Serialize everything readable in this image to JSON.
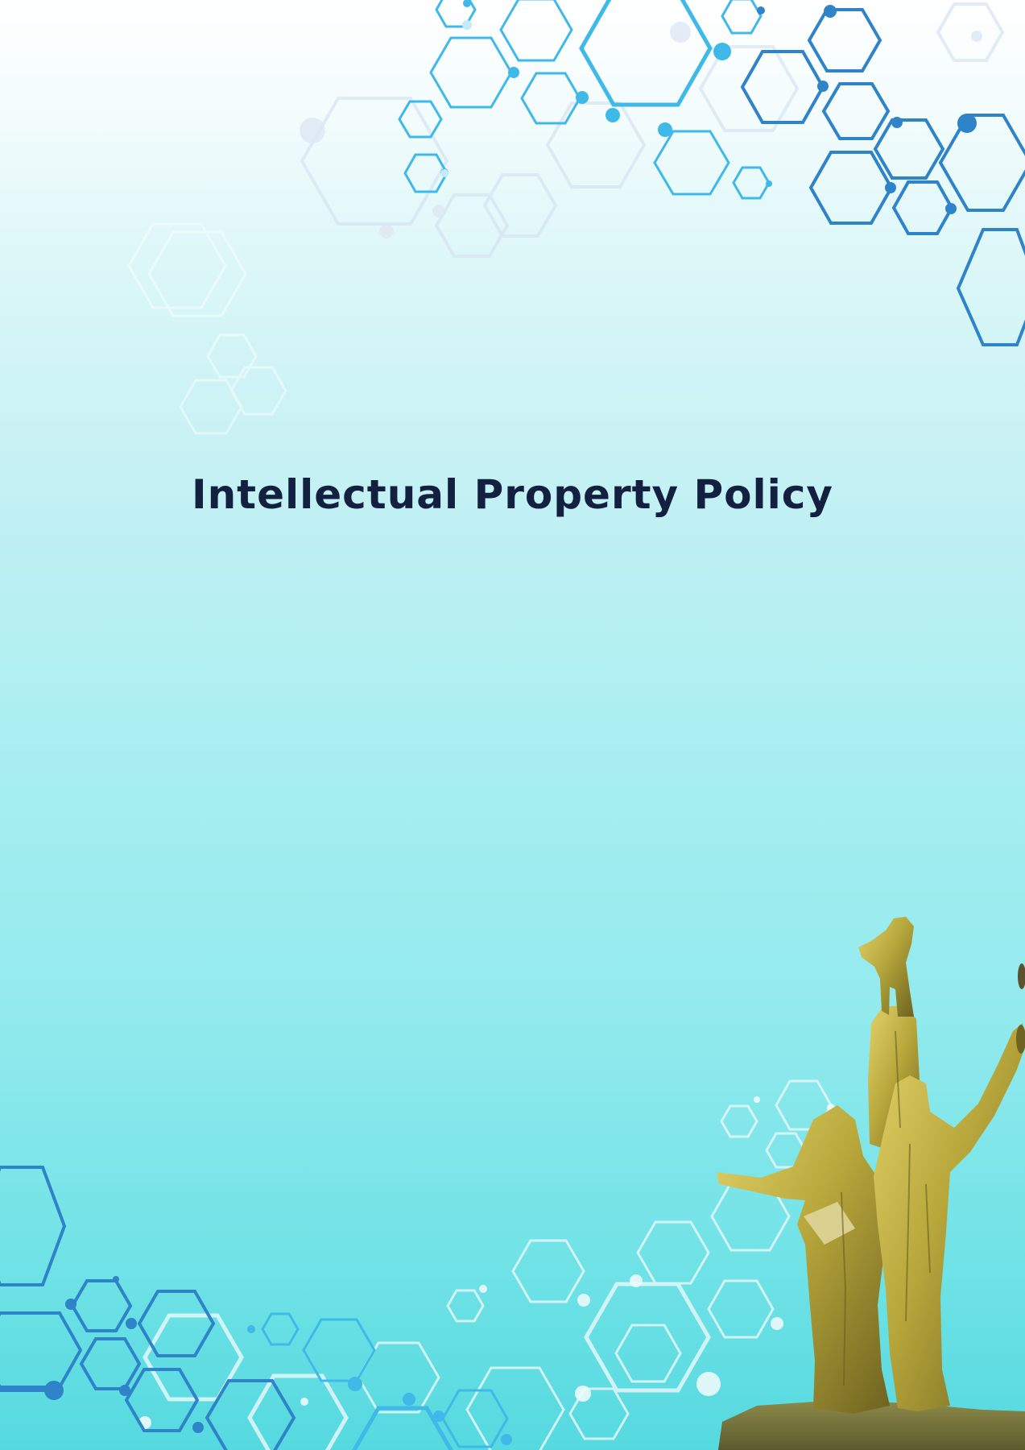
{
  "document": {
    "title": "Intellectual Property Policy"
  },
  "decorations": {
    "top_right": "hexagon-network-graphic",
    "bottom": "hexagon-network-graphic",
    "bottom_right": "golden-statue-monument"
  },
  "colors": {
    "title": "#13203f",
    "hex_dark": "#2f7fc6",
    "hex_mid": "#3fb7e6",
    "hex_light": "#c9eef6",
    "statue_gold": "#b9a83c"
  }
}
